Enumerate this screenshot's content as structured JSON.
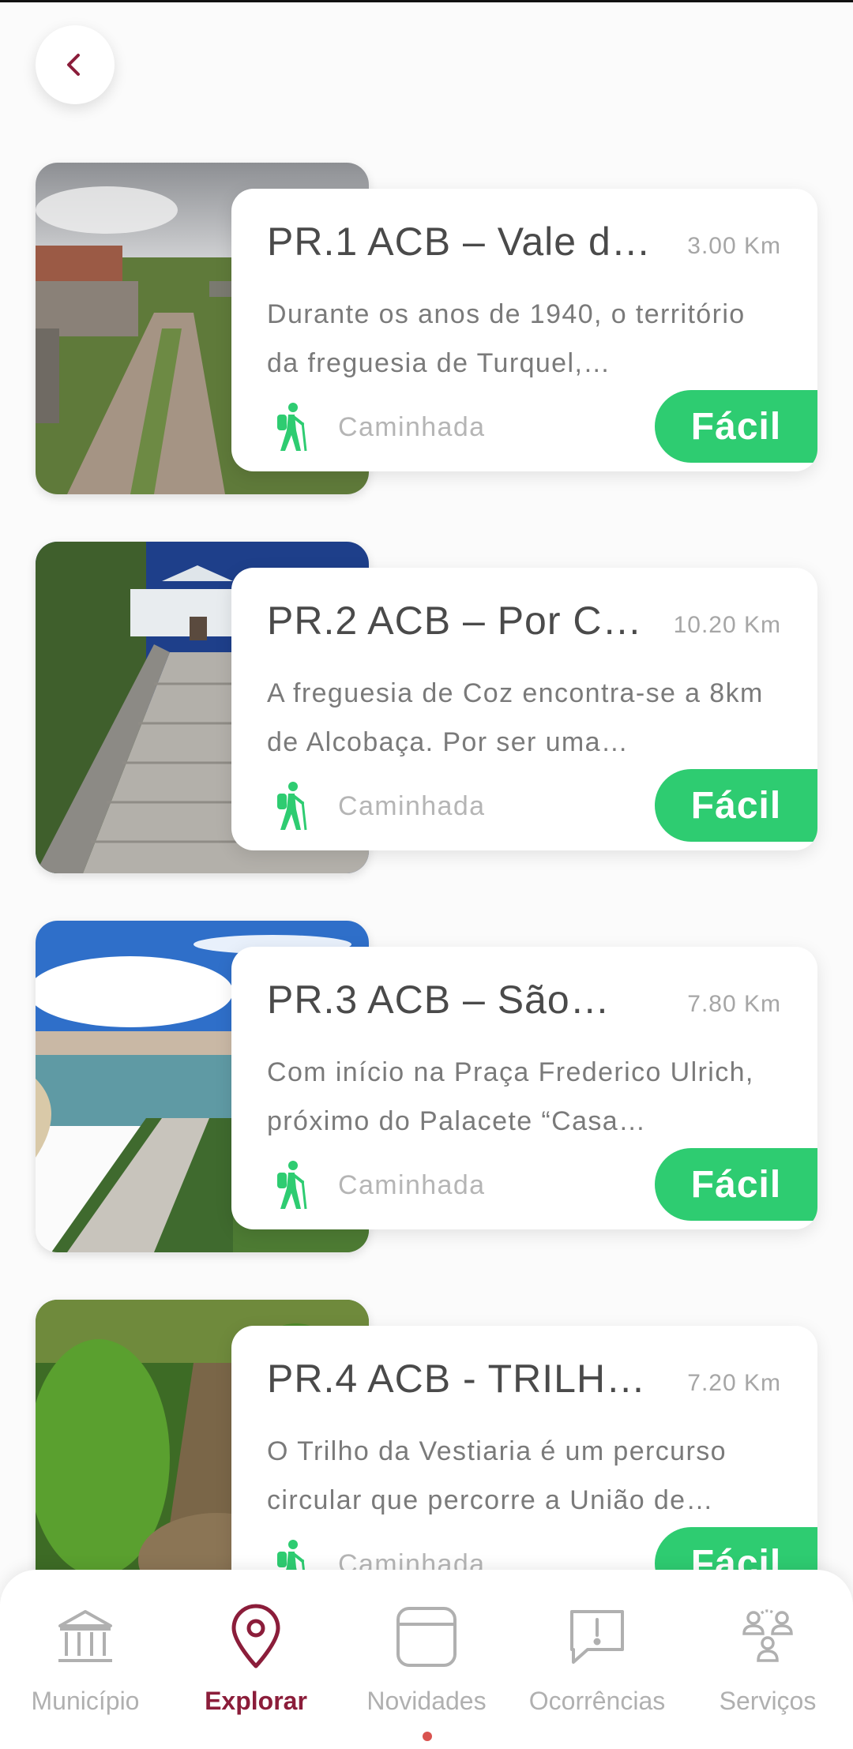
{
  "colors": {
    "accent": "#8b1d3a",
    "easy": "#2ecc71",
    "muted": "#b0b0b0"
  },
  "back_icon": "chevron-left-icon",
  "trails": [
    {
      "title": "PR.1 ACB – Vale de…",
      "distance": "3.00 Km",
      "description": "Durante os anos de 1940, o território da freguesia de Turquel,…",
      "activity": "Caminhada",
      "difficulty": "Fácil"
    },
    {
      "title": "PR.2 ACB – Por Co…",
      "distance": "10.20 Km",
      "description": "A freguesia de Coz encontra-se a 8km de Alcobaça. Por ser uma…",
      "activity": "Caminhada",
      "difficulty": "Fácil"
    },
    {
      "title": "PR.3 ACB – São…",
      "distance": "7.80 Km",
      "description": "Com início na Praça Frederico Ulrich, próximo do Palacete “Casa…",
      "activity": "Caminhada",
      "difficulty": "Fácil"
    },
    {
      "title": "PR.4 ACB - TRILHO…",
      "distance": "7.20 Km",
      "description": "O Trilho da Vestiaria é um percurso circular que percorre a União de…",
      "activity": "Caminhada",
      "difficulty": "Fácil"
    }
  ],
  "nav": [
    {
      "label": "Município",
      "icon": "building-icon",
      "active": false
    },
    {
      "label": "Explorar",
      "icon": "location-pin-icon",
      "active": true
    },
    {
      "label": "Novidades",
      "icon": "window-icon",
      "active": false
    },
    {
      "label": "Ocorrências",
      "icon": "alert-chat-icon",
      "active": false
    },
    {
      "label": "Serviços",
      "icon": "people-icon",
      "active": false
    }
  ]
}
